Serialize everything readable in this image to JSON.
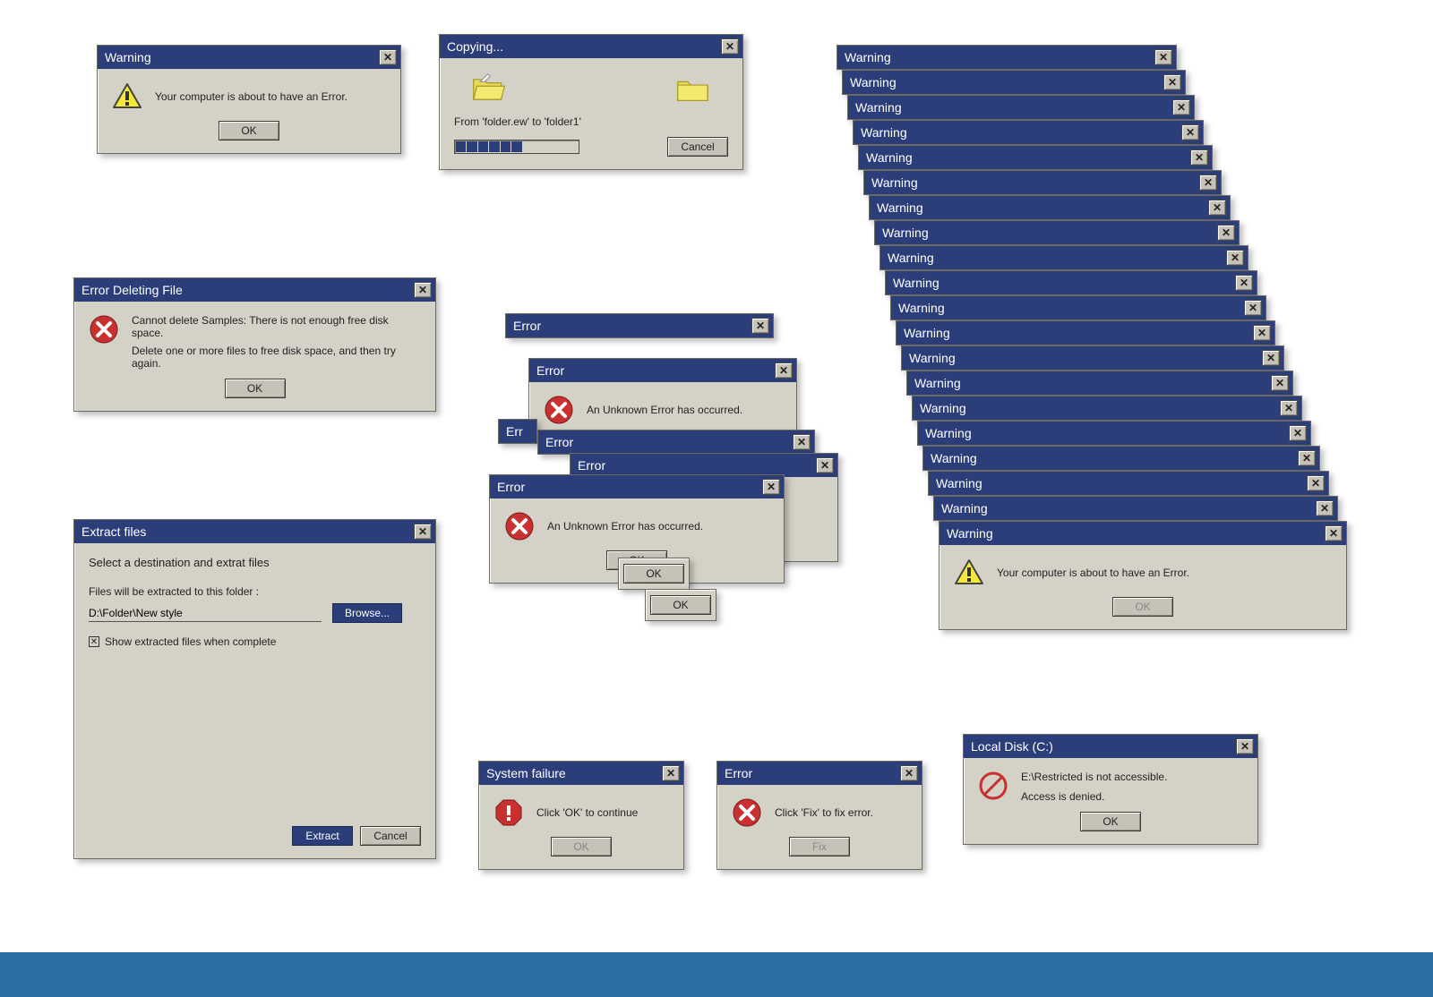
{
  "warning1": {
    "title": "Warning",
    "message": "Your computer is about to have an Error.",
    "ok": "OK"
  },
  "copying": {
    "title": "Copying...",
    "from_to": "From 'folder.ew' to 'folder1'",
    "cancel": "Cancel",
    "progress_filled": 6,
    "progress_total": 11
  },
  "deleting": {
    "title": "Error Deleting File",
    "line1": "Cannot delete Samples: There is not enough free disk space.",
    "line2": "Delete one or more files to free disk space, and then try again.",
    "ok": "OK"
  },
  "extract": {
    "title": "Extract files",
    "heading": "Select a destination and extrat files",
    "sub": "Files will be extracted to this folder :",
    "path": "D:\\Folder\\New style",
    "browse": "Browse...",
    "checkbox": "Show extracted files when complete",
    "extract_btn": "Extract",
    "cancel": "Cancel"
  },
  "error_cascade": {
    "title": "Error",
    "message": "An Unknown Error has occurred.",
    "partial": "has occurred.",
    "ok": "OK"
  },
  "warning_cascade": {
    "title": "Warning",
    "message": "Your computer is about to have an Error.",
    "ok": "OK"
  },
  "sysfail": {
    "title": "System failure",
    "message": "Click 'OK' to continue",
    "ok": "OK"
  },
  "errorfix": {
    "title": "Error",
    "message": "Click 'Fix' to fix error.",
    "fix": "Fix"
  },
  "localdisk": {
    "title": "Local Disk (C:)",
    "line1": "E:\\Restricted is not accessible.",
    "line2": "Access is denied.",
    "ok": "OK"
  }
}
